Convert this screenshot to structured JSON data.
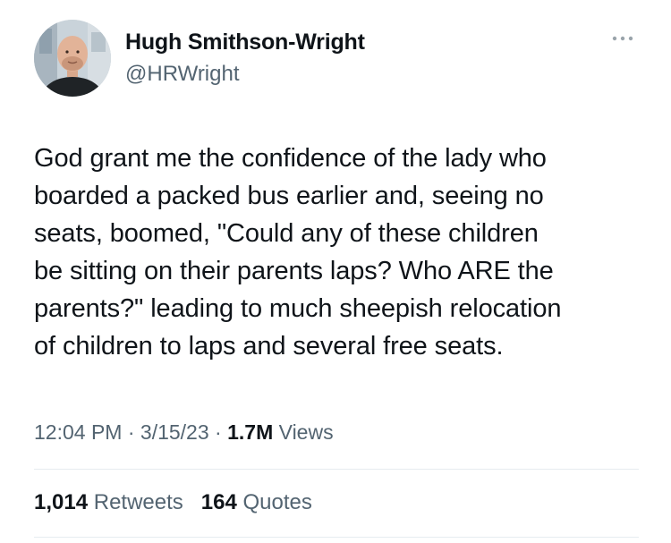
{
  "author": {
    "display_name": "Hugh Smithson-Wright",
    "handle": "@HRWright"
  },
  "tweet": {
    "lines": [
      "God grant me the confidence of the lady who",
      "boarded a packed bus earlier and, seeing no",
      "seats, boomed, \"Could any of these children",
      "be sitting on their parents laps? Who ARE the",
      "parents?\" leading to much sheepish relocation",
      "of children to laps and several free seats."
    ]
  },
  "meta": {
    "time": "12:04 PM",
    "separator": "·",
    "date": "3/15/23",
    "views_count": "1.7M",
    "views_label": "Views"
  },
  "stats": {
    "retweets_count": "1,014",
    "retweets_label": "Retweets",
    "quotes_count": "164",
    "quotes_label": "Quotes"
  },
  "icons": {
    "more": "more-horizontal-icon",
    "avatar": "profile-photo"
  },
  "colors": {
    "text_primary": "#0f1419",
    "text_secondary": "#536471",
    "divider": "#e6ecf0"
  }
}
